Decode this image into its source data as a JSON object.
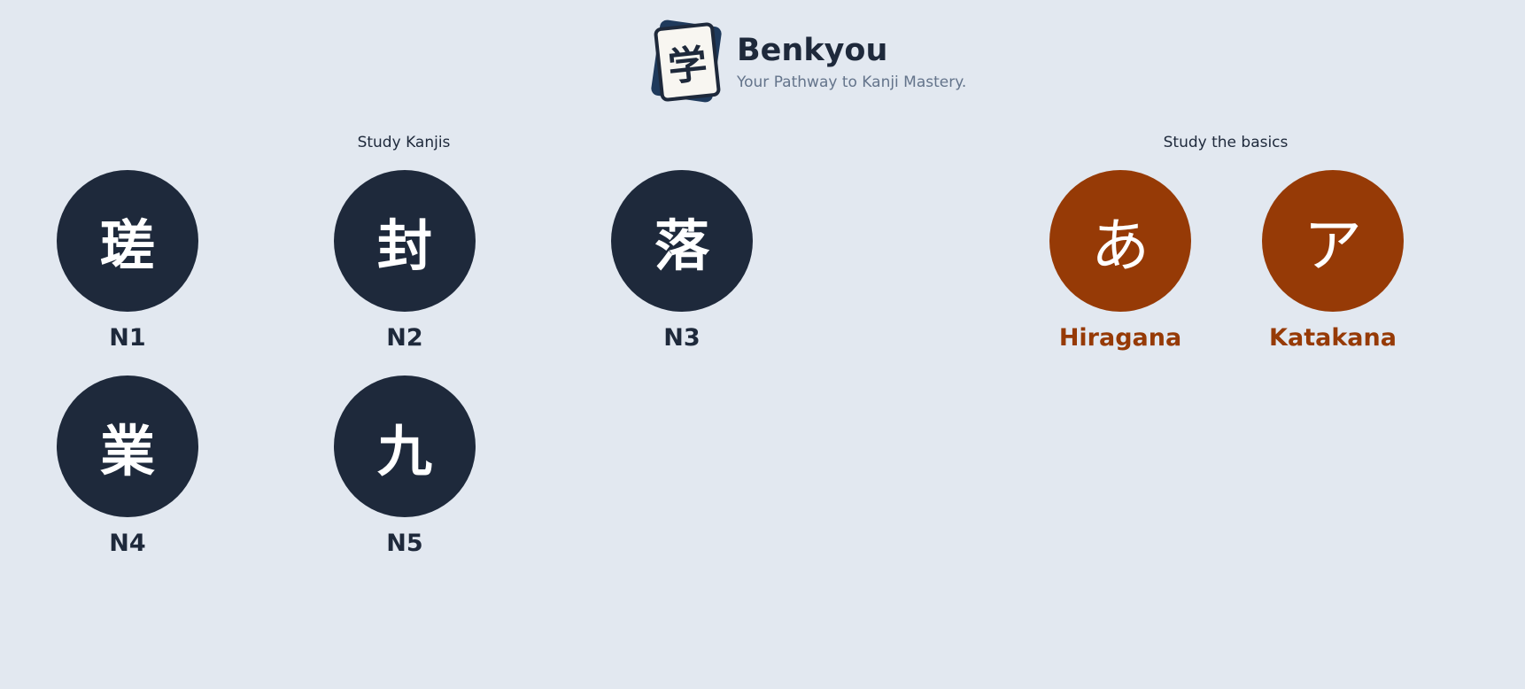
{
  "header": {
    "logo_glyph": "学",
    "title": "Benkyou",
    "tagline": "Your Pathway to Kanji Mastery."
  },
  "sections": {
    "kanji_label": "Study Kanjis",
    "basics_label": "Study the basics"
  },
  "kanji_levels": [
    {
      "glyph": "瑳",
      "label": "N1"
    },
    {
      "glyph": "封",
      "label": "N2"
    },
    {
      "glyph": "落",
      "label": "N3"
    },
    {
      "glyph": "業",
      "label": "N4"
    },
    {
      "glyph": "九",
      "label": "N5"
    }
  ],
  "basics": [
    {
      "glyph": "あ",
      "label": "Hiragana"
    },
    {
      "glyph": "ア",
      "label": "Katakana"
    }
  ],
  "colors": {
    "background": "#e2e8f0",
    "kanji_circle": "#1e293b",
    "basics_circle": "#963a06"
  }
}
